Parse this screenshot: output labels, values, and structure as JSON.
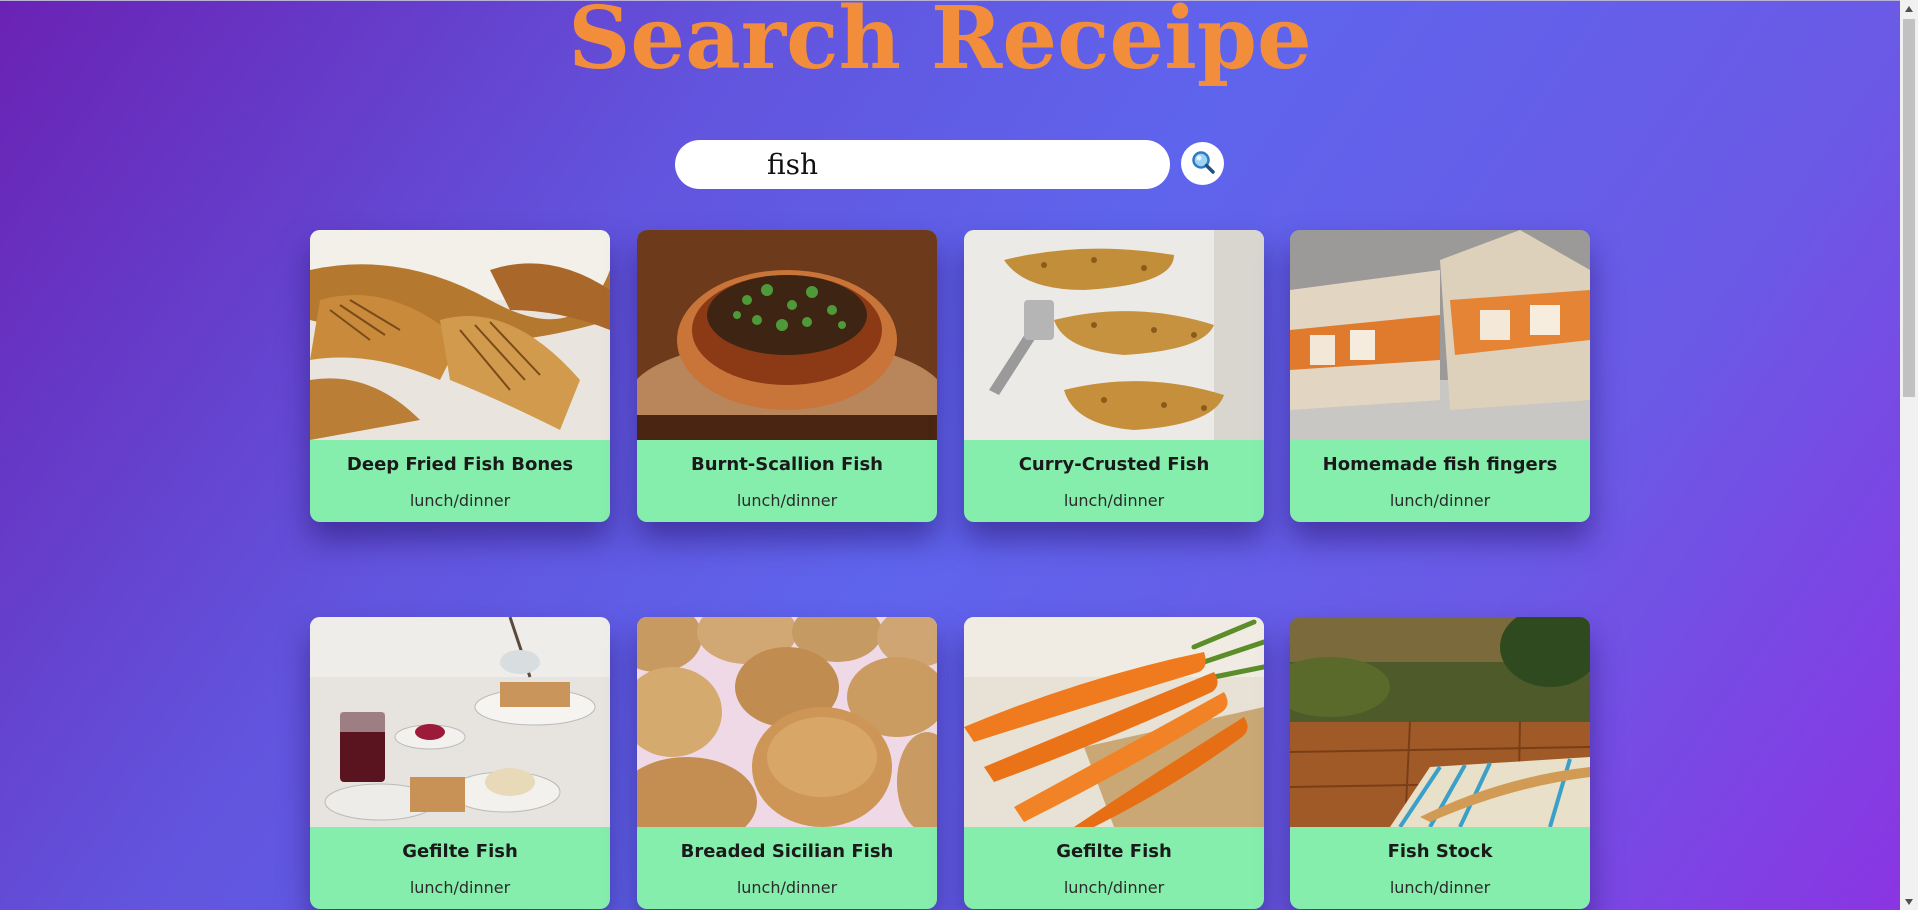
{
  "header": {
    "title": "Search Receipe"
  },
  "search": {
    "value": "fish",
    "button_icon": "search-icon"
  },
  "colors": {
    "title": "#f28d3c",
    "card_footer": "#86eeac",
    "background_start": "#6a22b4",
    "background_end": "#8b34e2"
  },
  "recipes": [
    {
      "title": "Deep Fried Fish Bones",
      "meal": "lunch/dinner",
      "image": "fried-fish-bones-photo"
    },
    {
      "title": "Burnt-Scallion Fish",
      "meal": "lunch/dinner",
      "image": "scallion-fish-photo"
    },
    {
      "title": "Curry-Crusted Fish",
      "meal": "lunch/dinner",
      "image": "crusted-fish-photo"
    },
    {
      "title": "Homemade fish fingers",
      "meal": "lunch/dinner",
      "image": "fish-finger-sandwich-photo"
    },
    {
      "title": "Gefilte Fish",
      "meal": "lunch/dinner",
      "image": "gefilte-fish-table-photo"
    },
    {
      "title": "Breaded Sicilian Fish",
      "meal": "lunch/dinner",
      "image": "bread-rolls-photo"
    },
    {
      "title": "Gefilte Fish",
      "meal": "lunch/dinner",
      "image": "carrots-photo"
    },
    {
      "title": "Fish Stock",
      "meal": "lunch/dinner",
      "image": "wooden-table-photo"
    }
  ]
}
